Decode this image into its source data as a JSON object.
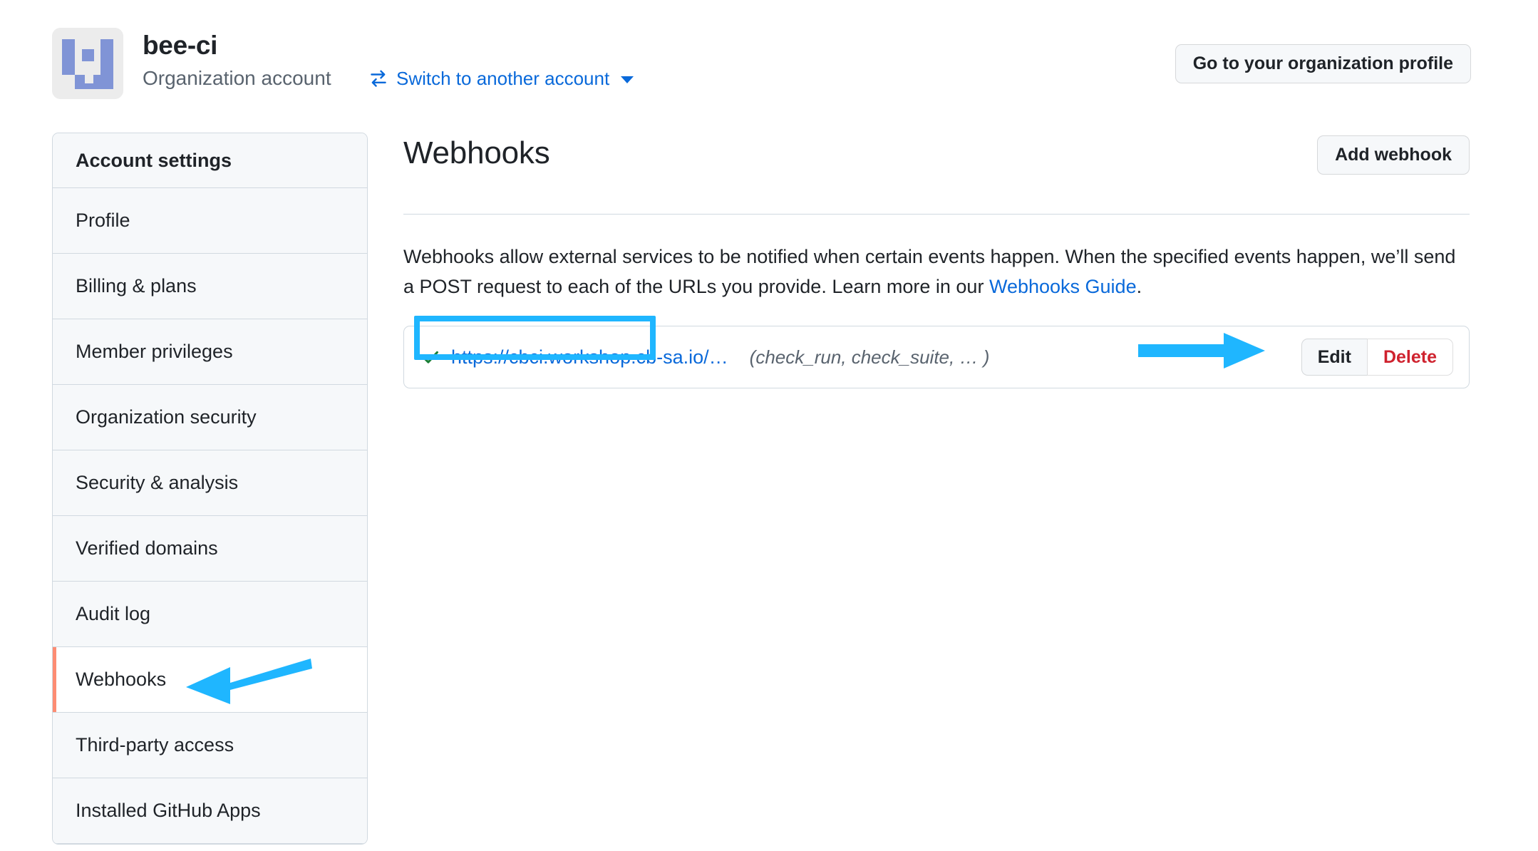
{
  "header": {
    "avatar_name": "bee-ci-avatar",
    "avatar_bg": "#ececec",
    "avatar_fg": "#8094d6",
    "org_name": "bee-ci",
    "account_type": "Organization account",
    "switch_account_label": "Switch to another account",
    "switch_icon": "arrow-switch-icon",
    "caret_icon": "chevron-down-icon",
    "org_profile_button": "Go to your organization profile",
    "link_color": "#0969da"
  },
  "sidebar": {
    "title": "Account settings",
    "selected": "Webhooks",
    "selected_indicator_color": "#fd8c73",
    "items": [
      {
        "label": "Profile",
        "selected": false
      },
      {
        "label": "Billing & plans",
        "selected": false
      },
      {
        "label": "Member privileges",
        "selected": false
      },
      {
        "label": "Organization security",
        "selected": false
      },
      {
        "label": "Security & analysis",
        "selected": false
      },
      {
        "label": "Verified domains",
        "selected": false
      },
      {
        "label": "Audit log",
        "selected": false
      },
      {
        "label": "Webhooks",
        "selected": true
      },
      {
        "label": "Third-party access",
        "selected": false
      },
      {
        "label": "Installed GitHub Apps",
        "selected": false
      }
    ]
  },
  "main": {
    "title": "Webhooks",
    "add_button": "Add webhook",
    "description_part1": "Webhooks allow external services to be notified when certain events happen. When the specified events happen, we’ll send a POST request to each of the URLs you provide. Learn more in our ",
    "description_link": "Webhooks Guide",
    "description_part2": ".",
    "webhooks": [
      {
        "status_icon": "check-icon",
        "status_color": "#1a7f37",
        "url": "https://cbci.workshop.cb-sa.io/…",
        "events": "(check_run, check_suite, … )",
        "edit_label": "Edit",
        "delete_label": "Delete",
        "delete_color": "#cf222e"
      }
    ]
  },
  "annotations": {
    "highlight_color": "#1fb6ff",
    "url_box_target": "webhook-url-link",
    "arrow_edit_target": "edit-button",
    "arrow_sidebar_target": "sidebar-item-webhooks"
  }
}
